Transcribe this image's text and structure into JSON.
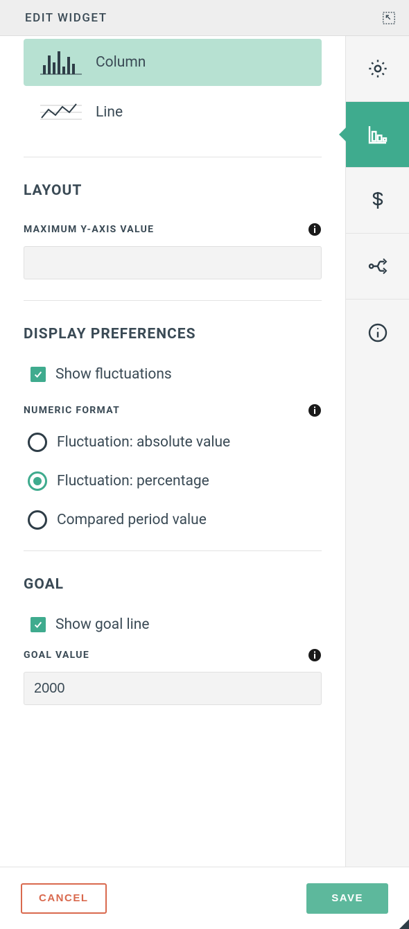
{
  "header": {
    "title": "EDIT WIDGET"
  },
  "chart_types": {
    "selected": "column",
    "options": [
      {
        "id": "column",
        "label": "Column"
      },
      {
        "id": "line",
        "label": "Line"
      }
    ]
  },
  "layout_section": {
    "title": "LAYOUT",
    "max_y_axis": {
      "label": "MAXIMUM Y-AXIS VALUE",
      "value": ""
    }
  },
  "display_section": {
    "title": "DISPLAY PREFERENCES",
    "show_fluctuations": {
      "label": "Show fluctuations",
      "checked": true
    },
    "numeric_format": {
      "label": "NUMERIC FORMAT",
      "selected": "percentage",
      "options": [
        {
          "id": "absolute",
          "label": "Fluctuation: absolute value"
        },
        {
          "id": "percentage",
          "label": "Fluctuation: percentage"
        },
        {
          "id": "compared",
          "label": "Compared period value"
        }
      ]
    }
  },
  "goal_section": {
    "title": "GOAL",
    "show_goal_line": {
      "label": "Show goal line",
      "checked": true
    },
    "goal_value": {
      "label": "GOAL VALUE",
      "value": "2000"
    }
  },
  "footer": {
    "cancel": "CANCEL",
    "save": "SAVE"
  },
  "nav_tabs": [
    {
      "id": "settings",
      "active": false
    },
    {
      "id": "chart",
      "active": true
    },
    {
      "id": "currency",
      "active": false
    },
    {
      "id": "data-source",
      "active": false
    },
    {
      "id": "info",
      "active": false
    }
  ]
}
